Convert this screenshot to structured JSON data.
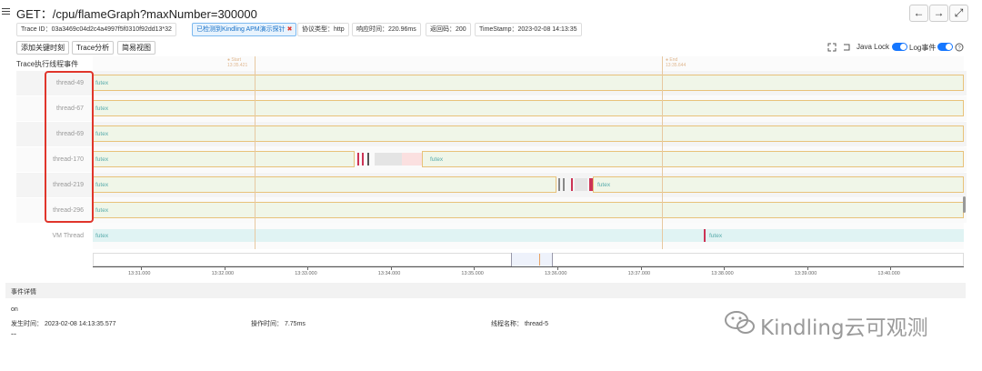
{
  "header": {
    "title": "GET：/cpu/flameGraph?maxNumber=300000",
    "back_icon": "←",
    "forward_icon": "→",
    "expand_icon": "⤢"
  },
  "meta": {
    "trace_id": "Trace ID：03a3469c04d2c4a4997f5f0310f92dd13*32",
    "apm_detect": "已检测到Kindling APM演示探针",
    "protocol": "协议类型：http",
    "response_time": "响应时间：220.96ms",
    "return_code": "返回码：200",
    "timestamp": "TimeStamp：2023-02-08 14:13:35"
  },
  "toolbar": {
    "add_key_time": "添加关键时刻",
    "trace_analysis": "Trace分析",
    "simple_view": "简易视图",
    "java_lock": "Java Lock",
    "log_event": "Log事件",
    "colors": {
      "accent": "#1677ff",
      "highlight": "#e0352b"
    }
  },
  "timeline": {
    "section_title": "Trace执行线程事件",
    "marker_start": "● Start",
    "marker_start_time": "13:35.421",
    "marker_end": "● End",
    "marker_end_time": "13:35.644",
    "threads": [
      {
        "name": "thread-49",
        "event": "futex",
        "event2": ""
      },
      {
        "name": "thread-67",
        "event": "futex",
        "event2": ""
      },
      {
        "name": "thread-69",
        "event": "futex",
        "event2": ""
      },
      {
        "name": "thread-170",
        "event": "futex",
        "event2": "futex"
      },
      {
        "name": "thread-219",
        "event": "futex",
        "event2": "futex"
      },
      {
        "name": "thread-296",
        "event": "futex",
        "event2": ""
      }
    ],
    "vm_thread": {
      "name": "VM Thread",
      "event": "futex",
      "event2": "futex"
    },
    "ticks": [
      "13:31.000",
      "13:32.000",
      "13:33.000",
      "13:34.000",
      "13:35.000",
      "13:36.000",
      "13:37.000",
      "13:38.000",
      "13:39.000",
      "13:40.000"
    ]
  },
  "details": {
    "section_title": "事件详情",
    "event_name": "on",
    "occur_time": "发生时间： 2023-02-08 14:13:35.577",
    "op_time": "操作时间： 7.75ms",
    "thread_name": "线程名称： thread-5",
    "dash": "--"
  },
  "watermark": "Kindling云可观测"
}
